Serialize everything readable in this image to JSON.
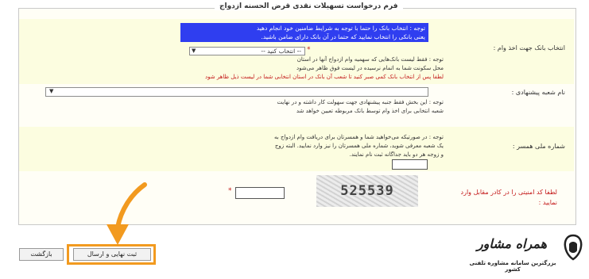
{
  "form": {
    "legend": "فرم درخواست تسهیلات نقدی قرض الحسنه ازدواج",
    "bank": {
      "label": "انتخاب بانک جهت اخذ وام :",
      "notice": "توجه : انتخاب بانک را حتما با توجه به شرایط ضامنین خود انجام دهید",
      "notice2": "یعنی بانکی را انتخاب نمایید که حتما در آن بانک دارای ضامن باشید.",
      "select_value": "-- انتخاب کنید --",
      "note1": "توجه : فقط لیست بانک‌هایی که سهمیه وام ازدواج آنها در استان",
      "note2": "محل سکونت شما به اتمام نرسیده در لیست فوق ظاهر می‌شود",
      "note3": "لطفا پس از انتخاب بانک کمی صبر کنید تا شعب آن بانک در استان انتخابی شما در لیست ذیل ظاهر شود"
    },
    "branch": {
      "label": "نام شعبه پیشنهادی :",
      "note1": "توجه : این بخش فقط جنبه پیشنهادی جهت سهولت کار داشته و در نهایت",
      "note2": "شعبه انتخابی برای اخذ وام توسط بانک مربوطه تعیین خواهد شد"
    },
    "national_id": {
      "label": "شماره ملی همسر :",
      "note1": "توجه : در صورتیکه می‌خواهید شما و همسرتان برای دریافت وام ازدواج به",
      "note2": "یک شعبه معرفی شوید، شماره ملی همسرتان را نیز وارد نمایید. البته زوج",
      "note3": "و زوجه هر دو باید جداگانه ثبت نام نمایند."
    },
    "captcha": {
      "label": "لطفا کد امنیتی را در کادر مقابل وارد نمایید :",
      "code": "525539"
    },
    "buttons": {
      "submit": "ثبت نهایی و ارسال",
      "back": "بازگشت"
    },
    "required_mark": "*"
  },
  "brand": {
    "title": "همراه مشاور",
    "subtitle": "بزرگترین سامانه مشاوره تلفنی کشور"
  },
  "colors": {
    "highlight_orange": "#f29a1f",
    "notice_blue": "#2f3ef0",
    "note_red": "#c41a1a"
  }
}
